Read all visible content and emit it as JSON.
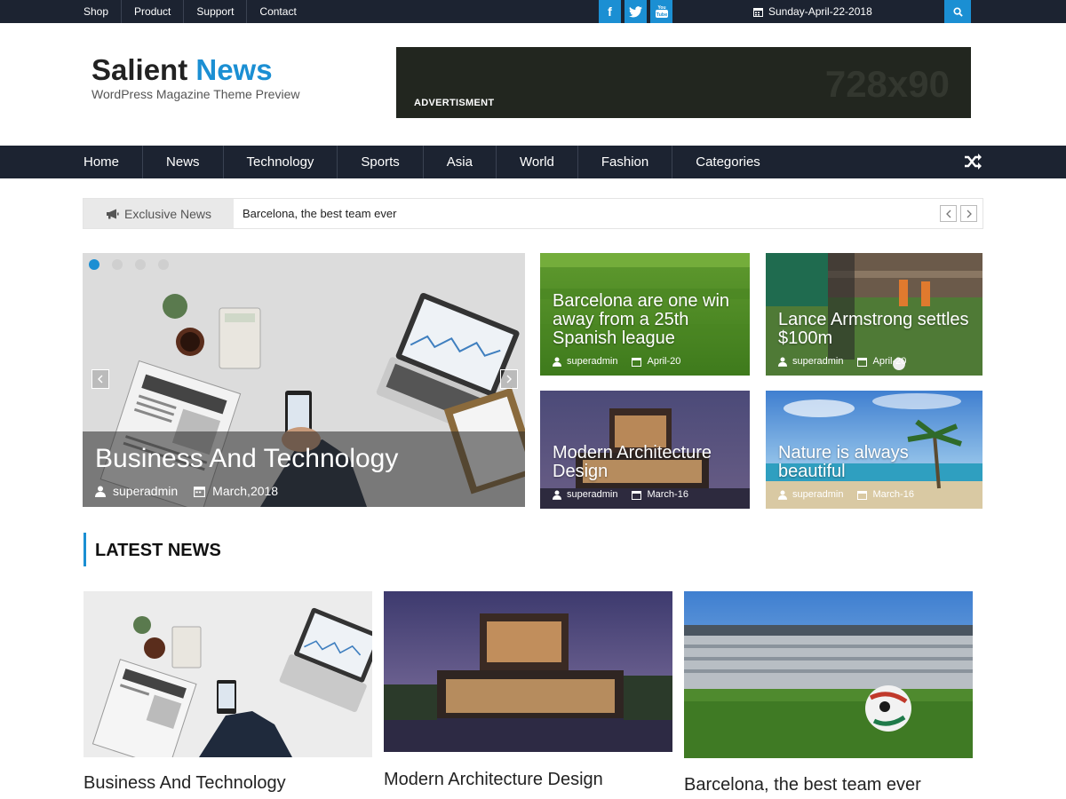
{
  "topbar": {
    "links": [
      "Shop",
      "Product",
      "Support",
      "Contact"
    ],
    "social": [
      {
        "icon": "facebook-icon",
        "glyph": "f"
      },
      {
        "icon": "twitter-icon",
        "glyph": "t"
      },
      {
        "icon": "youtube-icon",
        "glyph": "▶"
      }
    ],
    "date": "Sunday-April-22-2018"
  },
  "header": {
    "title_main": "Salient",
    "title_accent": "News",
    "tagline": "WordPress Magazine Theme Preview",
    "ad_label": "ADVERTISMENT",
    "ad_size": "728x90"
  },
  "nav": {
    "items": [
      "Home",
      "News",
      "Technology",
      "Sports",
      "Asia",
      "World",
      "Fashion",
      "Categories"
    ]
  },
  "ticker": {
    "label": "Exclusive News",
    "text": "Barcelona, the best team ever"
  },
  "slider": {
    "title": "Business And Technology",
    "author": "superadmin",
    "date": "March,2018",
    "dot_count": 4,
    "active_dot": 1
  },
  "cards": [
    {
      "title": "Barcelona are one win away from a 25th Spanish league",
      "author": "superadmin",
      "date": "April-20"
    },
    {
      "title": "Lance Armstrong settles $100m",
      "author": "superadmin",
      "date": "April-20"
    },
    {
      "title": "Modern Architecture Design",
      "author": "superadmin",
      "date": "March-16"
    },
    {
      "title": "Nature is always beautiful",
      "author": "superadmin",
      "date": "March-16"
    }
  ],
  "latest": {
    "heading": "LATEST NEWS",
    "items": [
      {
        "title": "Business And Technology"
      },
      {
        "title": "Modern Architecture Design"
      },
      {
        "title": "Barcelona, the best team ever"
      }
    ]
  },
  "colors": {
    "dark_navy": "#1c2331",
    "accent_blue": "#1b8fd3"
  }
}
